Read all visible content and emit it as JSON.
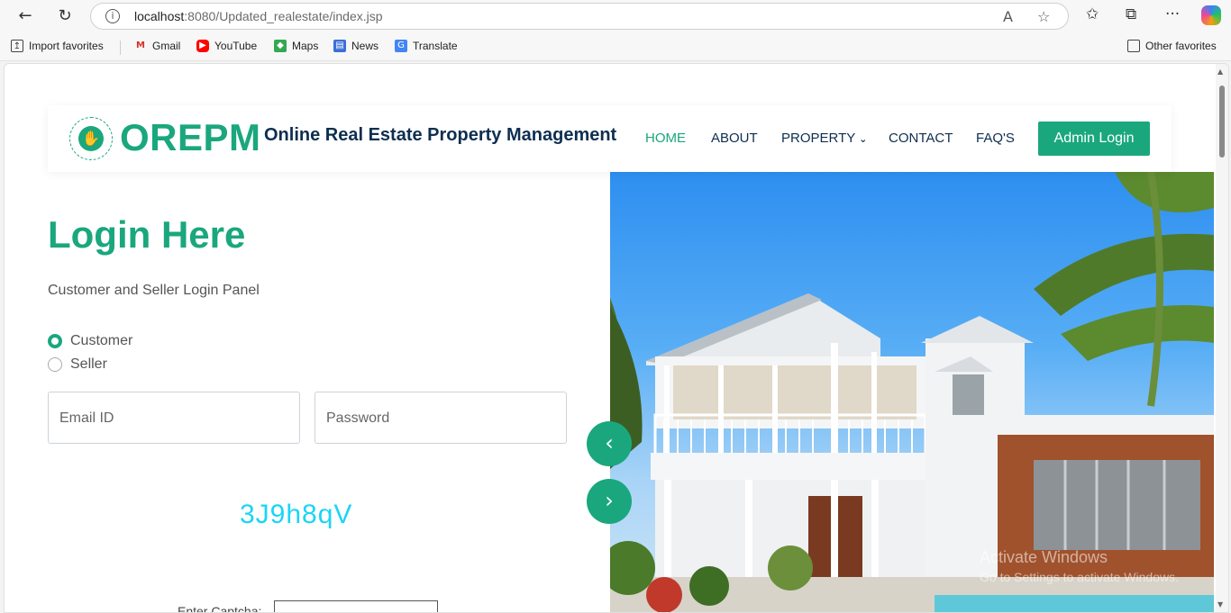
{
  "browser": {
    "url_host": "localhost",
    "url_rest": ":8080/Updated_realestate/index.jsp",
    "favorites": [
      {
        "label": "Import favorites",
        "icon": "import-favorites-icon"
      },
      {
        "label": "Gmail",
        "icon": "gmail-icon",
        "color": "#d93025"
      },
      {
        "label": "YouTube",
        "icon": "youtube-icon",
        "color": "#ff0000"
      },
      {
        "label": "Maps",
        "icon": "maps-icon",
        "color": "#34a853"
      },
      {
        "label": "News",
        "icon": "news-icon",
        "color": "#3b6fd8"
      },
      {
        "label": "Translate",
        "icon": "translate-icon",
        "color": "#4285f4"
      }
    ],
    "other_favorites": "Other favorites"
  },
  "site": {
    "brand": "OREPM",
    "tagline": "Online Real Estate Property Management",
    "nav": {
      "home": "HOME",
      "about": "ABOUT",
      "property": "PROPERTY",
      "contact": "CONTACT",
      "faq": "FAQ'S"
    },
    "admin_login": "Admin Login",
    "accent_color": "#1aa77d",
    "text_color": "#0e2e50"
  },
  "login": {
    "title": "Login Here",
    "subtitle": "Customer and Seller Login Panel",
    "roles": [
      "Customer",
      "Seller"
    ],
    "selected_role": "Customer",
    "email_placeholder": "Email ID",
    "password_placeholder": "Password",
    "captcha": "3J9h8qV",
    "captcha_label": "Enter Captcha:"
  },
  "hero": {
    "prev_icon": "chevron-left-icon",
    "next_icon": "chevron-right-icon"
  },
  "watermark": {
    "line1": "Activate Windows",
    "line2": "Go to Settings to activate Windows."
  }
}
